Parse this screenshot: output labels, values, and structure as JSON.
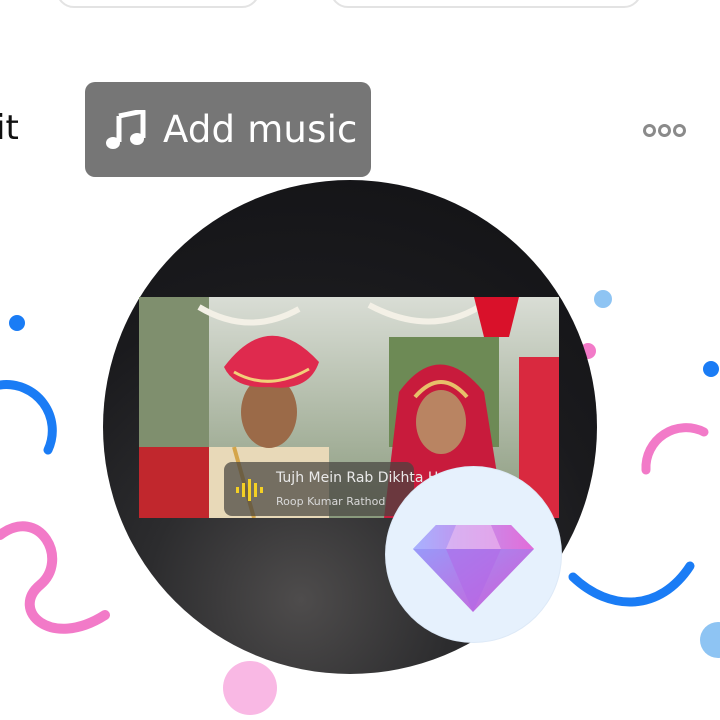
{
  "toolbar": {
    "edit_label_fragment": "it",
    "add_music_label": "Add music",
    "add_music_icon": "music-note-icon",
    "more_icon": "more-dots-icon"
  },
  "music_chip": {
    "title": "Tujh Mein Rab Dikhta H",
    "artist": "Roop Kumar Rathod",
    "icon": "sound-wave-icon"
  },
  "badge": {
    "icon": "diamond-gem-icon"
  },
  "colors": {
    "button_bg": "#767676",
    "disc_bg": "#1a1a1d",
    "badge_bg": "#e6f1fd",
    "confetti_blue": "#1a7cf5",
    "confetti_pink": "#f27ac8"
  }
}
